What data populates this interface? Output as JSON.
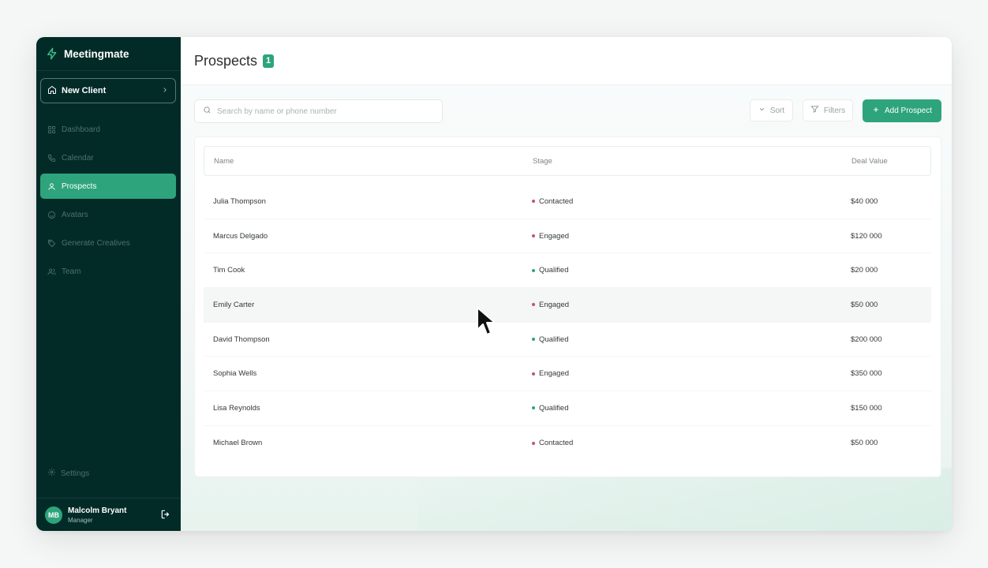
{
  "app": {
    "name": "Meetingmate"
  },
  "sidebar": {
    "new_client_label": "New Client",
    "items": [
      {
        "label": "Dashboard",
        "icon": "grid-icon"
      },
      {
        "label": "Calendar",
        "icon": "phone-icon"
      },
      {
        "label": "Prospects",
        "icon": "user-icon",
        "active": true
      },
      {
        "label": "Avatars",
        "icon": "smile-icon"
      },
      {
        "label": "Generate Creatives",
        "icon": "tag-icon"
      },
      {
        "label": "Team",
        "icon": "users-icon"
      }
    ],
    "settings_label": "Settings",
    "user": {
      "initials": "MB",
      "name": "Malcolm Bryant",
      "role": "Manager"
    }
  },
  "header": {
    "title": "Prospects",
    "count": "1"
  },
  "toolbar": {
    "search_placeholder": "Search by name or phone number",
    "sort_label": "Sort",
    "filters_label": "Filters",
    "add_label": "Add Prospect"
  },
  "table": {
    "columns": [
      "Name",
      "Stage",
      "Deal Value"
    ],
    "rows": [
      {
        "name": "Julia Thompson",
        "stage": "Contacted",
        "deal": "$40 000"
      },
      {
        "name": "Marcus Delgado",
        "stage": "Engaged",
        "deal": "$120 000"
      },
      {
        "name": "Tim Cook",
        "stage": "Qualified",
        "deal": "$20 000"
      },
      {
        "name": "Emily Carter",
        "stage": "Engaged",
        "deal": "$50 000"
      },
      {
        "name": "David Thompson",
        "stage": "Qualified",
        "deal": "$200 000"
      },
      {
        "name": "Sophia Wells",
        "stage": "Engaged",
        "deal": "$350 000"
      },
      {
        "name": "Lisa Reynolds",
        "stage": "Qualified",
        "deal": "$150 000"
      },
      {
        "name": "Michael Brown",
        "stage": "Contacted",
        "deal": "$50 000"
      }
    ]
  },
  "colors": {
    "sidebar_bg": "#022b27",
    "accent": "#2ea47c",
    "stage_contacted": "#c0566b",
    "stage_engaged": "#c0566b",
    "stage_qualified": "#2ea47c"
  }
}
